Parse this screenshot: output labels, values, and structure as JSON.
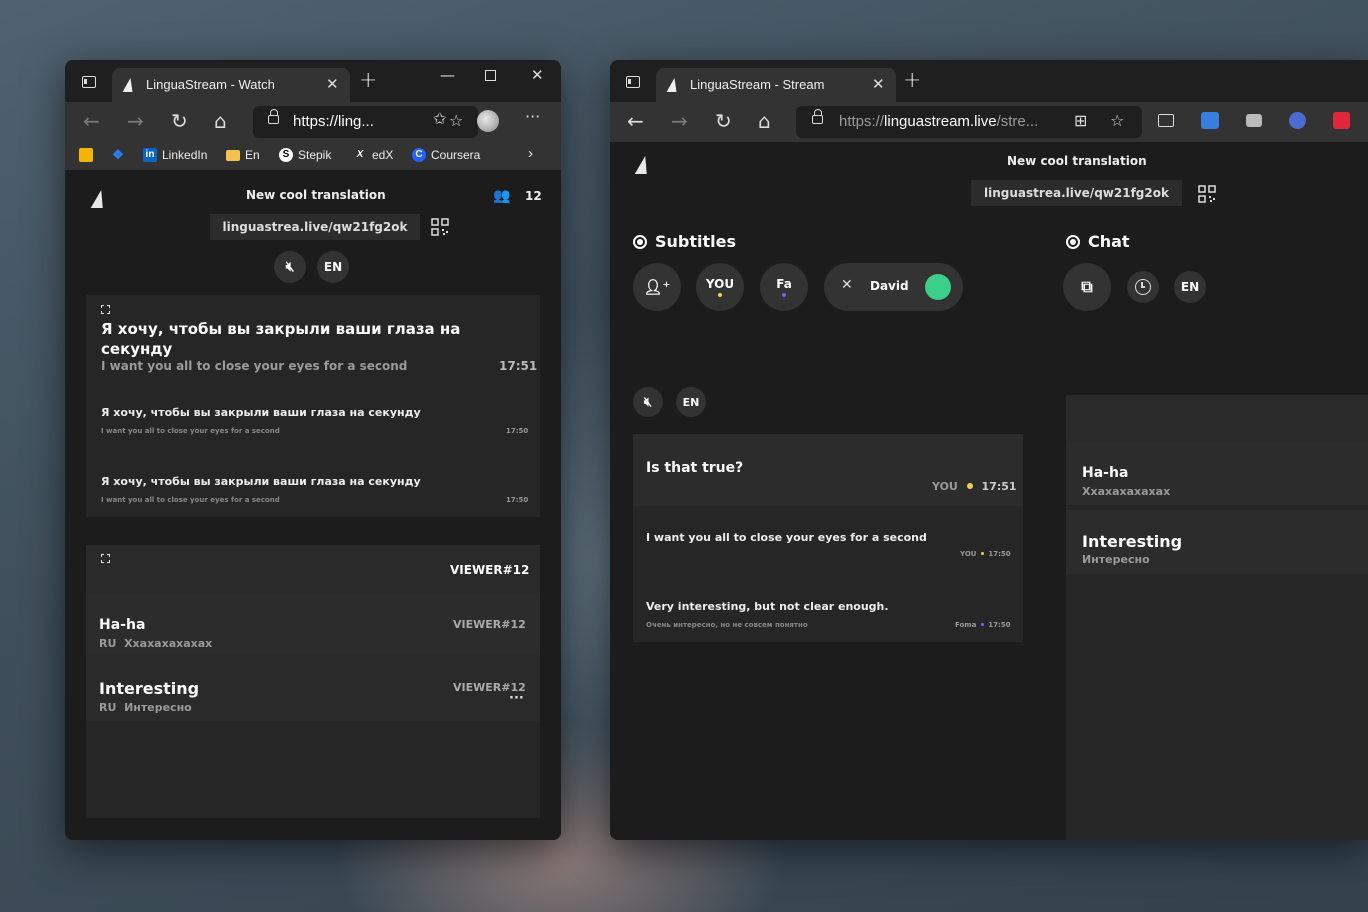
{
  "watch_window": {
    "tab_title": "LinguaStream - Watch",
    "url_prefix": "https://",
    "url_rest": "ling...",
    "bookmarks": [
      {
        "label": ""
      },
      {
        "label": ""
      },
      {
        "label": "LinkedIn"
      },
      {
        "label": "En"
      },
      {
        "label": "Stepik"
      },
      {
        "label": "edX"
      },
      {
        "label": "Coursera"
      }
    ],
    "app": {
      "title": "New cool translation",
      "viewer_count": "12",
      "link": "linguastrea.live/qw21fg2ok",
      "lang": "EN"
    },
    "subtitles": {
      "main": {
        "text": "Я хочу, чтобы вы закрыли ваши глаза на секунду",
        "translation": "I want you all to close your eyes for a second",
        "time": "17:51"
      },
      "items": [
        {
          "text": "Я хочу, чтобы вы закрыли ваши глаза на секунду",
          "translation": "I want you all to close your eyes for a second",
          "time": "17:50"
        },
        {
          "text": "Я хочу, чтобы вы закрыли ваши глаза на секунду",
          "translation": "I want you all to close your eyes for a second",
          "time": "17:50"
        }
      ]
    },
    "chat": {
      "header_viewer": "VIEWER#12",
      "messages": [
        {
          "name": "Ha-ha",
          "lang": "RU",
          "translation": "Ххахахахахах",
          "viewer": "VIEWER#12"
        },
        {
          "name": "Interesting",
          "lang": "RU",
          "translation": "Интересно",
          "viewer": "VIEWER#12",
          "more": "···"
        }
      ]
    }
  },
  "stream_window": {
    "tab_title": "LinguaStream - Stream",
    "url_prefix": "https://",
    "url_domain": "linguastream.live",
    "url_rest": "/stre...",
    "app": {
      "title": "New cool translation",
      "link": "linguastrea.live/qw21fg2ok"
    },
    "subtitles_section": {
      "heading": "Subtitles",
      "speakers": [
        {
          "label": "YOU",
          "dot_color": "#f0d24a"
        },
        {
          "label": "Fa",
          "dot_color": "#7c5cff"
        }
      ],
      "active_speaker": "David",
      "active_color": "#3ad08a",
      "lang": "EN",
      "messages": [
        {
          "text": "Is that true?",
          "author": "YOU",
          "time": "17:51"
        },
        {
          "text": "I want you all to close your eyes for a second",
          "author": "YOU",
          "time": "17:50"
        },
        {
          "text": "Very interesting, but not clear enough.",
          "translation": "Очень интересно, но не совсем понятно",
          "author": "Foma",
          "time": "17:50"
        }
      ]
    },
    "chat_section": {
      "heading": "Chat",
      "lang": "EN",
      "messages": [
        {
          "name": "Ha-ha",
          "translation": "Ххахахахахах"
        },
        {
          "name": "Interesting",
          "translation": "Интересно"
        }
      ]
    }
  },
  "colors": {
    "you_dot": "#f0d24a",
    "foma_dot": "#7c5cff",
    "active_green": "#3ad08a"
  }
}
